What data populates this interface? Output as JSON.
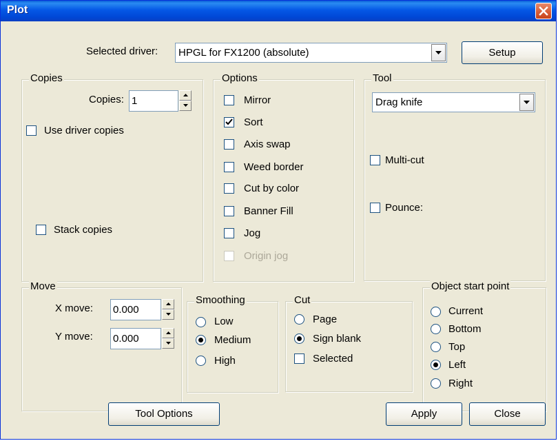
{
  "window": {
    "title": "Plot"
  },
  "driver": {
    "label": "Selected driver:",
    "value": "HPGL for FX1200 (absolute)",
    "setup": "Setup"
  },
  "copies": {
    "legend": "Copies",
    "copies_label": "Copies:",
    "copies_value": "1",
    "use_driver_copies": {
      "label": "Use driver copies",
      "checked": false
    },
    "stack_copies": {
      "label": "Stack copies",
      "checked": false
    }
  },
  "options": {
    "legend": "Options",
    "items": [
      {
        "label": "Mirror",
        "checked": false,
        "enabled": true
      },
      {
        "label": "Sort",
        "checked": true,
        "enabled": true
      },
      {
        "label": "Axis swap",
        "checked": false,
        "enabled": true
      },
      {
        "label": "Weed border",
        "checked": false,
        "enabled": true
      },
      {
        "label": "Cut by color",
        "checked": false,
        "enabled": true
      },
      {
        "label": "Banner Fill",
        "checked": false,
        "enabled": true
      },
      {
        "label": "Jog",
        "checked": false,
        "enabled": true
      },
      {
        "label": "Origin jog",
        "checked": false,
        "enabled": false
      }
    ]
  },
  "tool": {
    "legend": "Tool",
    "value": "Drag knife",
    "multicut": {
      "label": "Multi-cut",
      "checked": false
    },
    "pounce": {
      "label": "Pounce:",
      "checked": false
    }
  },
  "move": {
    "legend": "Move",
    "x_label": "X move:",
    "x_value": "0.000",
    "y_label": "Y move:",
    "y_value": "0.000"
  },
  "smoothing": {
    "legend": "Smoothing",
    "options": [
      "Low",
      "Medium",
      "High"
    ],
    "selected": "Medium"
  },
  "cut": {
    "legend": "Cut",
    "options": [
      "Page",
      "Sign blank"
    ],
    "selected": "Sign blank",
    "selected_cb": {
      "label": "Selected",
      "checked": false
    }
  },
  "start_point": {
    "legend": "Object start point",
    "options": [
      "Current",
      "Bottom",
      "Top",
      "Left",
      "Right"
    ],
    "selected": "Left"
  },
  "buttons": {
    "tool_options": "Tool Options",
    "apply": "Apply",
    "close": "Close"
  },
  "colors": {
    "title_bar": "#0558e6",
    "dialog_bg": "#ece9d8",
    "close_button": "#d65a34"
  }
}
